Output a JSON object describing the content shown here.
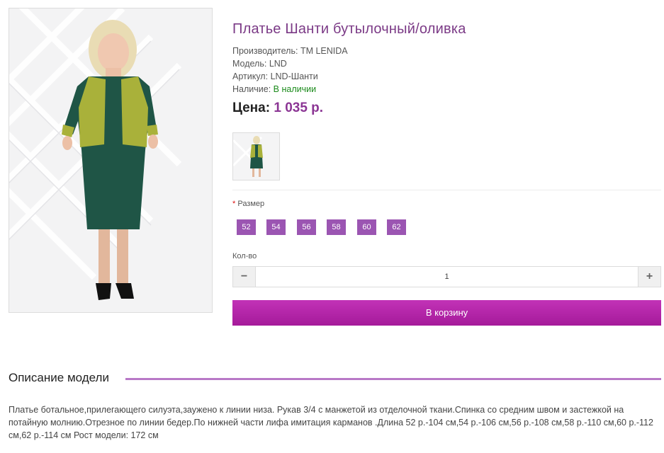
{
  "product": {
    "title": "Платье Шанти бутылочный/оливка",
    "manufacturer_label": "Производитель:",
    "manufacturer": "TM LENIDA",
    "model_label": "Модель:",
    "model": "LND",
    "sku_label": "Артикул:",
    "sku": "LND-Шанти",
    "availability_label": "Наличие:",
    "availability": "В наличии",
    "price_label": "Цена:",
    "price": "1 035 р."
  },
  "options": {
    "size_required_mark": "*",
    "size_label": "Размер",
    "sizes": [
      "52",
      "54",
      "56",
      "58",
      "60",
      "62"
    ]
  },
  "quantity": {
    "label": "Кол-во",
    "value": "1",
    "minus": "−",
    "plus": "+"
  },
  "cart_button": "В корзину",
  "description": {
    "heading": "Описание модели",
    "text": "Платье ботальное,прилегающего силуэта,заужено к линии низа. Рукав 3/4 с манжетой из отделочной ткани.Спинка со средним швом и застежкой на потайную молнию.Отрезное по линии бедер.По нижней части лифа имитация карманов .Длина 52 р.-104 см,54 р.-106 см,56 р.-108 см,58 р.-110 см,60 р.-112 см,62 р.-114 см Рост модели: 172 см"
  },
  "colors": {
    "accent": "#7b3a86",
    "size_button": "#9b55b2",
    "cart_button": "#b5249f",
    "in_stock": "#1a8a1a",
    "dress_main": "#1f5546",
    "dress_trim": "#a9b13a"
  }
}
